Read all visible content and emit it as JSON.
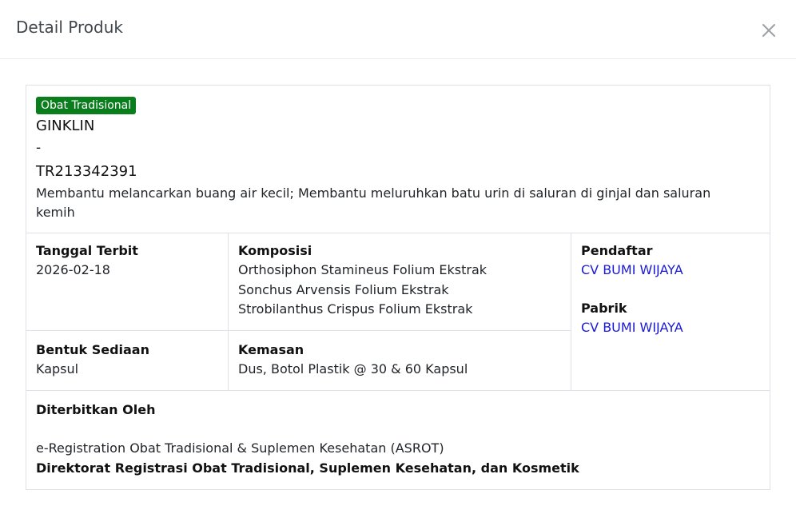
{
  "modal": {
    "title": "Detail Produk",
    "close_icon": "close-icon"
  },
  "product": {
    "category_badge": "Obat Tradisional",
    "badge_color": "#0a7d1c",
    "name": "GINKLIN",
    "subtitle": "-",
    "registration_number": "TR213342391",
    "description": "Membantu melancarkan buang air kecil; Membantu meluruhkan batu urin di saluran di ginjal dan saluran kemih"
  },
  "details": {
    "issue_date_label": "Tanggal Terbit",
    "issue_date": "2026-02-18",
    "composition_label": "Komposisi",
    "composition": [
      "Orthosiphon Stamineus Folium Ekstrak",
      "Sonchus Arvensis Folium Ekstrak",
      "Strobilanthus Crispus Folium Ekstrak"
    ],
    "registrant_label": "Pendaftar",
    "registrant": "CV BUMI WIJAYA",
    "manufacturer_label": "Pabrik",
    "manufacturer": "CV BUMI WIJAYA",
    "dosage_form_label": "Bentuk Sediaan",
    "dosage_form": "Kapsul",
    "packaging_label": "Kemasan",
    "packaging": "Dus, Botol Plastik @ 30 & 60 Kapsul",
    "link_color": "#1a1ad6"
  },
  "issuer": {
    "label": "Diterbitkan Oleh",
    "system": "e-Registration Obat Tradisional & Suplemen Kesehatan (ASROT)",
    "directorate": "Direktorat Registrasi Obat Tradisional, Suplemen Kesehatan, dan Kosmetik"
  }
}
